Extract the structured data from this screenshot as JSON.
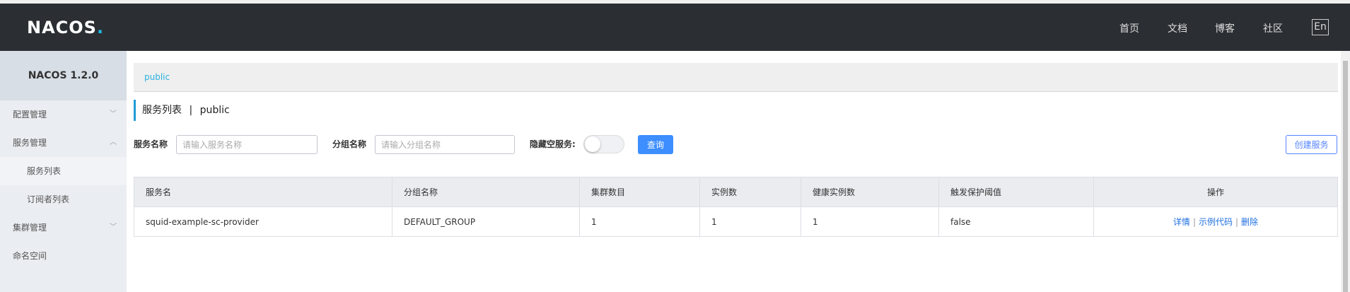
{
  "header": {
    "logo_main": "NACOS",
    "logo_dot": ".",
    "nav": [
      "首页",
      "文档",
      "博客",
      "社区"
    ],
    "lang": "En"
  },
  "sidebar": {
    "title": "NACOS 1.2.0",
    "items": [
      {
        "label": "配置管理"
      },
      {
        "label": "服务管理"
      },
      {
        "label": "服务列表"
      },
      {
        "label": "订阅者列表"
      },
      {
        "label": "集群管理"
      },
      {
        "label": "命名空间"
      }
    ]
  },
  "breadcrumb": "public",
  "page": {
    "title": "服务列表",
    "sep": "|",
    "namespace": "public"
  },
  "filters": {
    "service_label": "服务名称",
    "service_placeholder": "请输入服务名称",
    "group_label": "分组名称",
    "group_placeholder": "请输入分组名称",
    "hide_empty_label": "隐藏空服务:",
    "query": "查询",
    "create": "创建服务"
  },
  "table": {
    "columns": [
      "服务名",
      "分组名称",
      "集群数目",
      "实例数",
      "健康实例数",
      "触发保护阈值",
      "操作"
    ],
    "rows": [
      {
        "name": "squid-example-sc-provider",
        "group": "DEFAULT_GROUP",
        "clusters": "1",
        "instances": "1",
        "healthy": "1",
        "threshold": "false",
        "ops": [
          "详情",
          "示例代码",
          "删除"
        ]
      }
    ]
  }
}
